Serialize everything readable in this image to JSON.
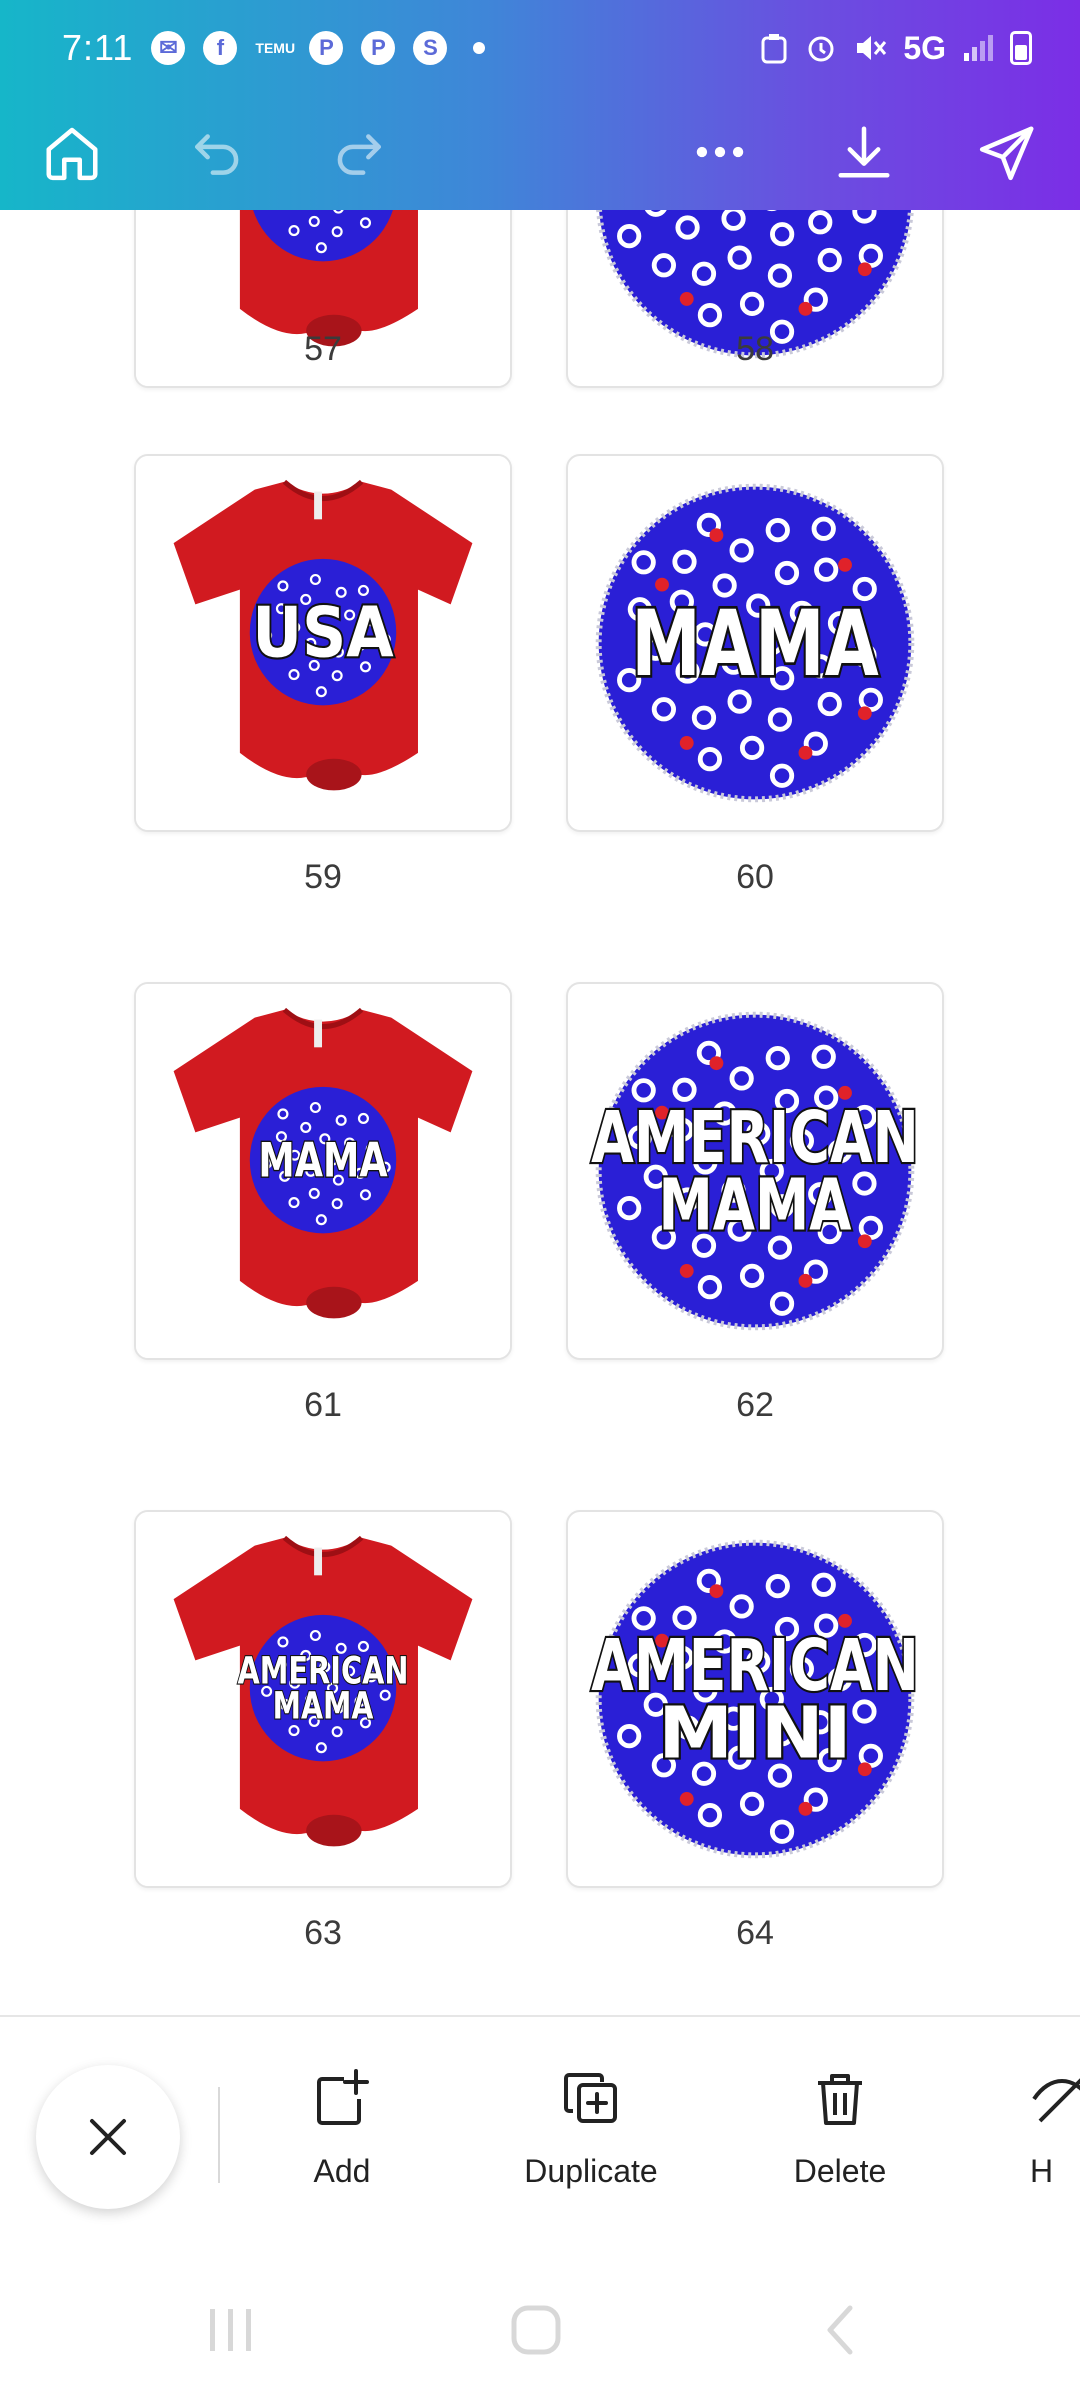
{
  "status_bar": {
    "time": "7:11",
    "temu": "TEMU",
    "network": "5G"
  },
  "toolbar": {
    "home": "home-icon",
    "undo": "undo-icon",
    "redo": "redo-icon",
    "more": "more-icon",
    "download": "download-icon",
    "share": "send-icon"
  },
  "pages": [
    {
      "number": "57",
      "kind": "tshirt"
    },
    {
      "number": "58",
      "kind": "circle"
    },
    {
      "number": "59",
      "kind": "tshirt",
      "text_lines": [
        "USA"
      ]
    },
    {
      "number": "60",
      "kind": "circle",
      "text_lines": [
        "MAMA"
      ]
    },
    {
      "number": "61",
      "kind": "tshirt",
      "text_lines": [
        "MAMA"
      ]
    },
    {
      "number": "62",
      "kind": "circle",
      "text_lines": [
        "AMERICAN",
        "MAMA"
      ]
    },
    {
      "number": "63",
      "kind": "tshirt",
      "text_lines": [
        "AMERICAN",
        "MAMA"
      ]
    },
    {
      "number": "64",
      "kind": "circle",
      "text_lines": [
        "AMERICAN",
        "MINI"
      ]
    }
  ],
  "colors": {
    "shirt_red": "#d11a20",
    "circle_blue": "#2a1fd6"
  },
  "actions": {
    "add": "Add",
    "duplicate": "Duplicate",
    "delete": "Delete",
    "more": "H"
  }
}
